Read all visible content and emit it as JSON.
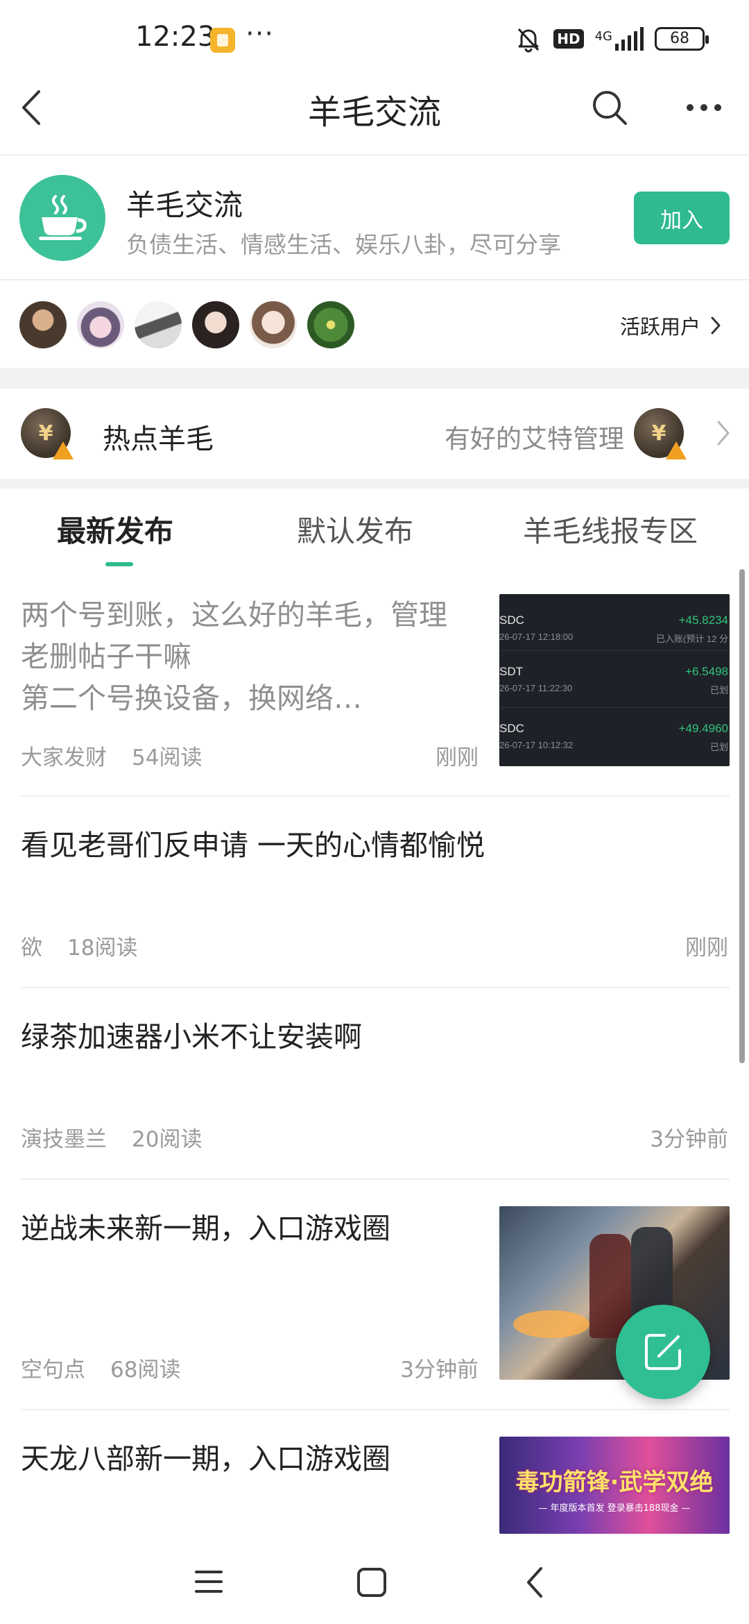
{
  "status_bar": {
    "time": "12:23",
    "more_dots": "···",
    "hd_badge": "HD",
    "network": "4G",
    "battery": "68"
  },
  "header": {
    "title": "羊毛交流"
  },
  "group": {
    "name": "羊毛交流",
    "description": "负债生活、情感生活、娱乐八卦，尽可分享",
    "join_label": "加入"
  },
  "members": {
    "active_users_label": "活跃用户"
  },
  "hot": {
    "title": "热点羊毛",
    "admin_text": "有好的艾特管理",
    "coin_symbol": "¥"
  },
  "tabs": [
    {
      "label": "最新发布",
      "active": true
    },
    {
      "label": "默认发布",
      "active": false
    },
    {
      "label": "羊毛线报专区",
      "active": false
    }
  ],
  "posts": [
    {
      "title_line1": "两个号到账，这么好的羊毛，管理",
      "title_line2": "老删帖子干嘛",
      "title_line3": "第二个号换设备，换网络…",
      "author": "大家发财",
      "reads": "54阅读",
      "time": "刚刚",
      "thumb_rows": [
        {
          "coin": "SDC",
          "date": "26-07-17 12:18:00",
          "amount": "+45.8234",
          "status": "已入账(预计 12 分"
        },
        {
          "coin": "SDT",
          "date": "26-07-17 11:22:30",
          "amount": "+6.5498",
          "status": "已划"
        },
        {
          "coin": "SDC",
          "date": "26-07-17 10:12:32",
          "amount": "+49.4960",
          "status": "已划"
        }
      ]
    },
    {
      "title": "看见老哥们反申请 一天的心情都愉悦",
      "author": "欲",
      "reads": "18阅读",
      "time": "刚刚"
    },
    {
      "title": "绿茶加速器小米不让安装啊",
      "author": "演技墨兰",
      "reads": "20阅读",
      "time": "3分钟前"
    },
    {
      "title": "逆战未来新一期，入口游戏圈",
      "author": "空句点",
      "reads": "68阅读",
      "time": "3分钟前"
    },
    {
      "title": "天龙八部新一期，入口游戏圈",
      "banner_title": "毒功箭锋·武学双绝",
      "banner_sub": "— 年度版本首发  登录暴击188现金 —"
    }
  ],
  "colors": {
    "accent": "#2fba8f",
    "text_primary": "#222222",
    "text_secondary": "#9a9a9a"
  },
  "icons": [
    "back-icon",
    "search-icon",
    "more-icon",
    "teacup-icon",
    "chevron-right-icon",
    "compose-icon",
    "menu-icon",
    "home-icon",
    "nav-back-icon"
  ]
}
